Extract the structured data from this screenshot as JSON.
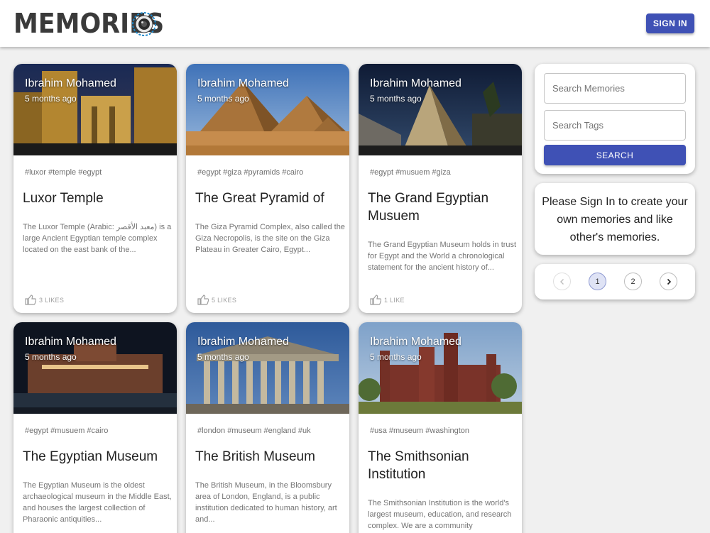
{
  "header": {
    "brand": "MEMORIES",
    "signin_label": "SIGN IN"
  },
  "posts": [
    {
      "author": "Ibrahim Mohamed",
      "time": "5 months ago",
      "tags": "#luxor #temple #egypt",
      "title": "Luxor Temple",
      "message": "The Luxor Temple (Arabic: معبد الأقصر) is a large Ancient Egyptian temple complex located on the east bank of the...",
      "likes": "3 LIKES",
      "image": "luxor-temple-photo"
    },
    {
      "author": "Ibrahim Mohamed",
      "time": "5 months ago",
      "tags": "#egypt #giza #pyramids #cairo",
      "title": "The Great Pyramid of",
      "message": "The Giza Pyramid Complex, also called the Giza Necropolis, is the site on the Giza Plateau in Greater Cairo, Egypt...",
      "likes": "5 LIKES",
      "image": "giza-pyramids-photo"
    },
    {
      "author": "Ibrahim Mohamed",
      "time": "5 months ago",
      "tags": "#egypt #musuem #giza",
      "title": "The Grand Egyptian Musuem",
      "message": "The Grand Egyptian Museum holds in trust for Egypt and the World a chronological statement for the ancient history of...",
      "likes": "1 LIKE",
      "image": "grand-egyptian-museum-photo"
    },
    {
      "author": "Ibrahim Mohamed",
      "time": "5 months ago",
      "tags": "#egypt #musuem #cairo",
      "title": "The Egyptian Museum",
      "message": "The Egyptian Museum is the oldest archaeological museum in the Middle East, and houses the largest collection of Pharaonic antiquities...",
      "likes": "",
      "image": "egyptian-museum-photo"
    },
    {
      "author": "Ibrahim Mohamed",
      "time": "5 months ago",
      "tags": "#london #museum #england #uk",
      "title": "The British Museum",
      "message": "The British Museum, in the Bloomsbury area of London, England, is a public institution dedicated to human history, art and...",
      "likes": "",
      "image": "british-museum-photo"
    },
    {
      "author": "Ibrahim Mohamed",
      "time": "5 months ago",
      "tags": "#usa #museum #washington",
      "title": "The Smithsonian Institution",
      "message": "The Smithsonian Institution is the world's largest museum, education, and research complex. We are a community",
      "likes": "",
      "image": "smithsonian-castle-photo"
    }
  ],
  "search": {
    "memories_placeholder": "Search Memories",
    "tags_placeholder": "Search Tags",
    "button_label": "SEARCH"
  },
  "signin_notice": "Please Sign In to create your own memories and like other's memories.",
  "pagination": {
    "current": 1,
    "pages": [
      "1",
      "2"
    ]
  },
  "colors": {
    "primary": "#3f51b5",
    "page_background": "#f0f0f0"
  }
}
